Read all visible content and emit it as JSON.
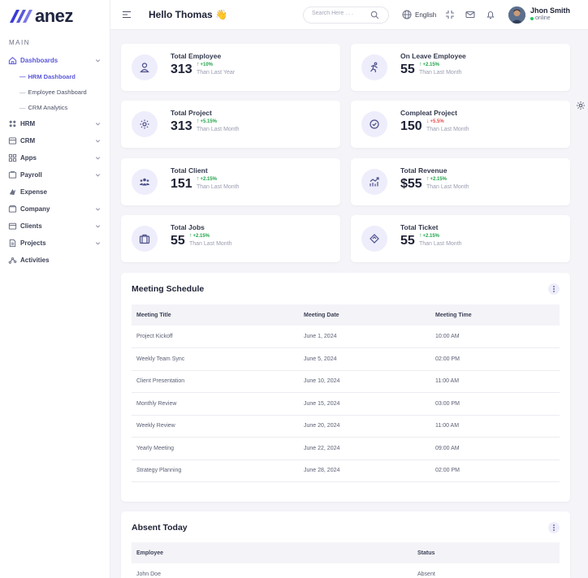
{
  "brand": {
    "logo_text": "anez",
    "accent": "#5b57d9"
  },
  "sidebar": {
    "section_label": "MAIN",
    "items": [
      {
        "label": "Dashboards",
        "icon": "home-icon",
        "active": true,
        "has_children": true,
        "children": [
          {
            "label": "HRM Dashboard",
            "active": true
          },
          {
            "label": "Employee Dashboard",
            "active": false
          },
          {
            "label": "CRM Analytics",
            "active": false
          }
        ]
      },
      {
        "label": "HRM",
        "icon": "hrm-icon",
        "has_children": true
      },
      {
        "label": "CRM",
        "icon": "crm-icon",
        "has_children": true
      },
      {
        "label": "Apps",
        "icon": "apps-grid-icon",
        "has_children": true
      },
      {
        "label": "Payroll",
        "icon": "payroll-icon",
        "has_children": true
      },
      {
        "label": "Expense",
        "icon": "expense-icon",
        "has_children": false
      },
      {
        "label": "Company",
        "icon": "company-icon",
        "has_children": true
      },
      {
        "label": "Clients",
        "icon": "clients-icon",
        "has_children": true
      },
      {
        "label": "Projects",
        "icon": "projects-icon",
        "has_children": true
      },
      {
        "label": "Activities",
        "icon": "activities-icon",
        "has_children": false
      }
    ]
  },
  "topbar": {
    "greeting": "Hello Thomas 👋",
    "search_placeholder": "Search Here . . .",
    "language": "English",
    "user_name": "Jhon Smith",
    "user_status": "online"
  },
  "stats": [
    {
      "label": "Total Employee",
      "value": "313",
      "trend": "+10%",
      "direction": "up",
      "period": "Than Last Year",
      "icon": "user-icon"
    },
    {
      "label": "On Leave Employee",
      "value": "55",
      "trend": "+2.15%",
      "direction": "up",
      "period": "Than Last Month",
      "icon": "running-person-icon"
    },
    {
      "label": "Total Project",
      "value": "313",
      "trend": "+5.15%",
      "direction": "up",
      "period": "Than Last Month",
      "icon": "gear-icon"
    },
    {
      "label": "Compleat Project",
      "value": "150",
      "trend": "+5.5%",
      "direction": "down",
      "period": "Than Last Month",
      "icon": "check-badge-icon"
    },
    {
      "label": "Total Client",
      "value": "151",
      "trend": "+2.15%",
      "direction": "up",
      "period": "Than Last Month",
      "icon": "users-group-icon"
    },
    {
      "label": "Total Revenue",
      "value": "$55",
      "trend": "+2.15%",
      "direction": "up",
      "period": "Than Last Month",
      "icon": "chart-up-icon"
    },
    {
      "label": "Total Jobs",
      "value": "55",
      "trend": "+2.15%",
      "direction": "up",
      "period": "Than Last Month",
      "icon": "briefcase-icon"
    },
    {
      "label": "Total Ticket",
      "value": "55",
      "trend": "+2.15%",
      "direction": "up",
      "period": "Than Last Month",
      "icon": "ticket-icon"
    }
  ],
  "meetings": {
    "title": "Meeting Schedule",
    "columns": [
      "Meeting Title",
      "Meeting Date",
      "Meeting Time"
    ],
    "rows": [
      [
        "Project Kickoff",
        "June 1, 2024",
        "10:00 AM"
      ],
      [
        "Weekly Team Sync",
        "June 5, 2024",
        "02:00 PM"
      ],
      [
        "Client Presentation",
        "June 10, 2024",
        "11:00 AM"
      ],
      [
        "Monthly Review",
        "June 15, 2024",
        "03:00 PM"
      ],
      [
        "Weekly Review",
        "June 20, 2024",
        "11:00 AM"
      ],
      [
        "Yearly Meeting",
        "June 22, 2024",
        "09:00 AM"
      ],
      [
        "Strategy Planning",
        "June 28, 2024",
        "02:00 PM"
      ]
    ]
  },
  "absent": {
    "title": "Absent Today",
    "columns": [
      "Employee",
      "Status"
    ],
    "rows": [
      [
        "John Doe",
        "Absent"
      ]
    ]
  }
}
